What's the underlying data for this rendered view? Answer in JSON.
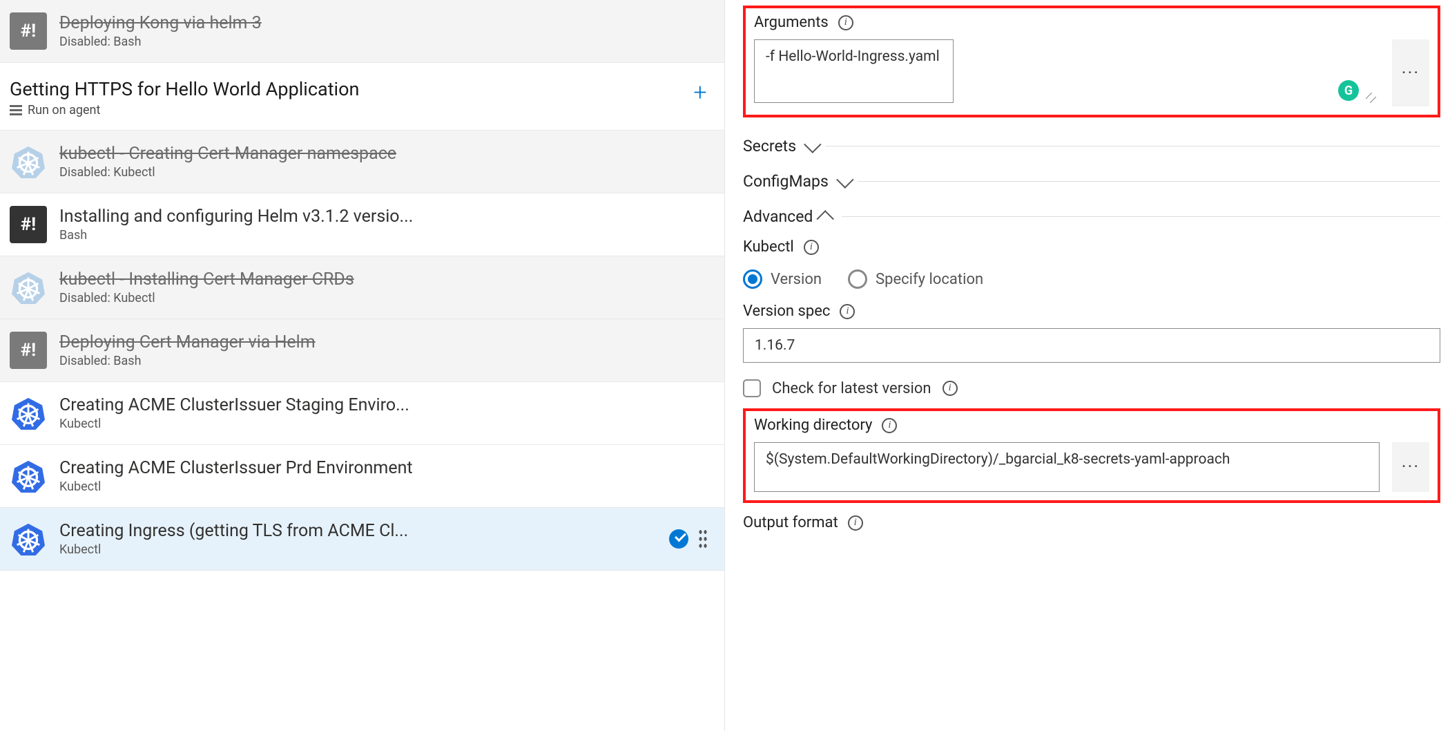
{
  "tasks": [
    {
      "title": "Deploying Kong via helm 3",
      "sub": "Disabled: Bash",
      "type": "bash",
      "disabled": true
    },
    {
      "stage": true,
      "title": "Getting HTTPS for Hello World Application",
      "sub": "Run on agent"
    },
    {
      "title": "kubectl - Creating Cert-Manager namespace",
      "sub": "Disabled: Kubectl",
      "type": "kube",
      "disabled": true
    },
    {
      "title": "Installing and configuring Helm v3.1.2 versio...",
      "sub": "Bash",
      "type": "bash",
      "disabled": false
    },
    {
      "title": "kubectl - Installing Cert Manager CRDs",
      "sub": "Disabled: Kubectl",
      "type": "kube",
      "disabled": true
    },
    {
      "title": "Deploying Cert Manager via Helm",
      "sub": "Disabled: Bash",
      "type": "bash",
      "disabled": true
    },
    {
      "title": "Creating ACME ClusterIssuer Staging Enviro...",
      "sub": "Kubectl",
      "type": "kube",
      "disabled": false
    },
    {
      "title": "Creating ACME ClusterIssuer Prd Environment",
      "sub": "Kubectl",
      "type": "kube",
      "disabled": false
    },
    {
      "title": "Creating Ingress (getting TLS from ACME Cl...",
      "sub": "Kubectl",
      "type": "kube",
      "disabled": false,
      "selected": true
    }
  ],
  "right": {
    "arguments_label": "Arguments",
    "arguments_value": "-f Hello-World-Ingress.yaml",
    "grammarly_badge": "G",
    "secrets_label": "Secrets",
    "configmaps_label": "ConfigMaps",
    "advanced_label": "Advanced",
    "kubectl_label": "Kubectl",
    "radio_version": "Version",
    "radio_location": "Specify location",
    "version_spec_label": "Version spec",
    "version_spec_value": "1.16.7",
    "check_latest_label": "Check for latest version",
    "workdir_label": "Working directory",
    "workdir_value": "$(System.DefaultWorkingDirectory)/_bgarcial_k8-secrets-yaml-approach",
    "output_format_label": "Output format"
  },
  "icons": {
    "bash_glyph": "#!"
  }
}
